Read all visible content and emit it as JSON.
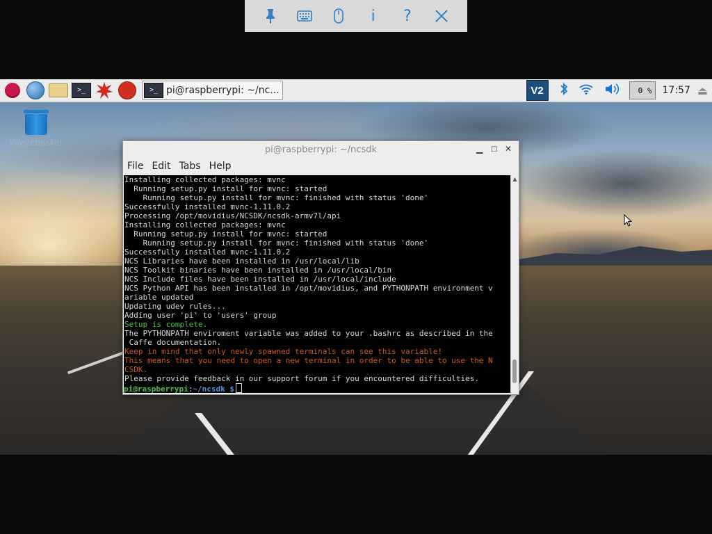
{
  "vnc_toolbar": {
    "items": [
      {
        "name": "pin",
        "glyph": "📌"
      },
      {
        "name": "keyboard",
        "glyph": "⌨"
      },
      {
        "name": "mouse",
        "glyph": "🖱"
      },
      {
        "name": "info",
        "glyph": "i"
      },
      {
        "name": "help",
        "glyph": "?"
      },
      {
        "name": "close",
        "glyph": "✕"
      }
    ]
  },
  "panel": {
    "task_label": "pi@raspberrypi: ~/nc...",
    "cpu_label": "0 %",
    "clock": "17:57",
    "vnc_label": "V2"
  },
  "desktop": {
    "trash_label": "Wastebasket"
  },
  "terminal": {
    "title": "pi@raspberrypi: ~/ncsdk",
    "menu": [
      "File",
      "Edit",
      "Tabs",
      "Help"
    ],
    "lines": [
      {
        "text": "Installing collected packages: mvnc",
        "color": "normal"
      },
      {
        "text": "  Running setup.py install for mvnc: started",
        "color": "normal"
      },
      {
        "text": "    Running setup.py install for mvnc: finished with status 'done'",
        "color": "normal"
      },
      {
        "text": "Successfully installed mvnc-1.11.0.2",
        "color": "normal"
      },
      {
        "text": "Processing /opt/movidius/NCSDK/ncsdk-armv7l/api",
        "color": "normal"
      },
      {
        "text": "Installing collected packages: mvnc",
        "color": "normal"
      },
      {
        "text": "  Running setup.py install for mvnc: started",
        "color": "normal"
      },
      {
        "text": "    Running setup.py install for mvnc: finished with status 'done'",
        "color": "normal"
      },
      {
        "text": "Successfully installed mvnc-1.11.0.2",
        "color": "normal"
      },
      {
        "text": "NCS Libraries have been installed in /usr/local/lib",
        "color": "normal"
      },
      {
        "text": "NCS Toolkit binaries have been installed in /usr/local/bin",
        "color": "normal"
      },
      {
        "text": "NCS Include files have been installed in /usr/local/include",
        "color": "normal"
      },
      {
        "text": "NCS Python API has been installed in /opt/movidius, and PYTHONPATH environment v",
        "color": "normal"
      },
      {
        "text": "ariable updated",
        "color": "normal"
      },
      {
        "text": "Updating udev rules...",
        "color": "normal"
      },
      {
        "text": "Adding user 'pi' to 'users' group",
        "color": "normal"
      },
      {
        "text": "Setup is complete.",
        "color": "green"
      },
      {
        "text": "The PYTHONPATH enviroment variable was added to your .bashrc as described in the",
        "color": "normal"
      },
      {
        "text": " Caffe documentation.",
        "color": "normal"
      },
      {
        "text": "Keep in mind that only newly spawned terminals can see this variable!",
        "color": "orange"
      },
      {
        "text": "This means that you need to open a new terminal in order to be able to use the N",
        "color": "orange"
      },
      {
        "text": "CSDK.",
        "color": "orange"
      },
      {
        "text": "Please provide feedback in our support forum if you encountered difficulties.",
        "color": "normal"
      }
    ],
    "prompt": {
      "user": "pi@raspberrypi",
      "sep": ":",
      "path": "~/ncsdk $"
    }
  },
  "colors": {
    "terminal_green": "#4ec04e",
    "terminal_orange": "#d05a1d",
    "prompt_path": "#5b8fd8",
    "vnc_accent": "#2f80c8"
  }
}
